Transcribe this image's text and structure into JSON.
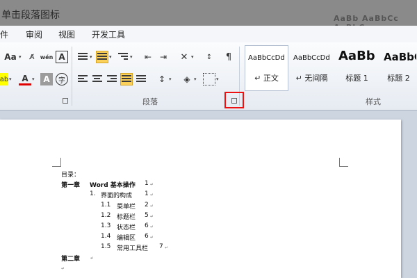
{
  "window": {
    "title": "单击段落图标",
    "ghost_text": "AaBb AaBbCc AaBbCc"
  },
  "menu": {
    "items": [
      "件",
      "审阅",
      "视图",
      "开发工具"
    ]
  },
  "ribbon": {
    "font_size_btn": "Aa",
    "phonetic_btn": "wén",
    "char_border_btn": "A",
    "font_color_btn": "A",
    "char_shading_btn": "A",
    "enclose_btn": "字",
    "paragraph_group": "段落",
    "styles_group": "样式",
    "styles": [
      {
        "sample": "AaBbCcDd",
        "name": "↵ 正文"
      },
      {
        "sample": "AaBbCcDd",
        "name": "↵ 无间隔"
      },
      {
        "sample": "AaBb",
        "name": "标题 1"
      },
      {
        "sample": "AaBbC",
        "name": "标题 2"
      }
    ],
    "colors": {
      "highlight": "#ffff00",
      "font_color": "#e00000",
      "accent_selected": "#fbd15c",
      "callout": "#e11111"
    }
  },
  "document": {
    "lines": [
      {
        "text": "目录："
      },
      {
        "label": "第一章",
        "title": "Word 基本操作",
        "page": "1"
      },
      {
        "label": "1.",
        "title": "界面的构成",
        "page": "1"
      },
      {
        "label": "1.1",
        "title": "菜单栏",
        "page": "2"
      },
      {
        "label": "1.2",
        "title": "标题栏",
        "page": "5"
      },
      {
        "label": "1.3",
        "title": "状态栏",
        "page": "6"
      },
      {
        "label": "1.4",
        "title": "编辑区",
        "page": "6"
      },
      {
        "label": "1.5",
        "title": "常用工具栏",
        "page": "7"
      },
      {
        "label": "第二章"
      }
    ]
  }
}
